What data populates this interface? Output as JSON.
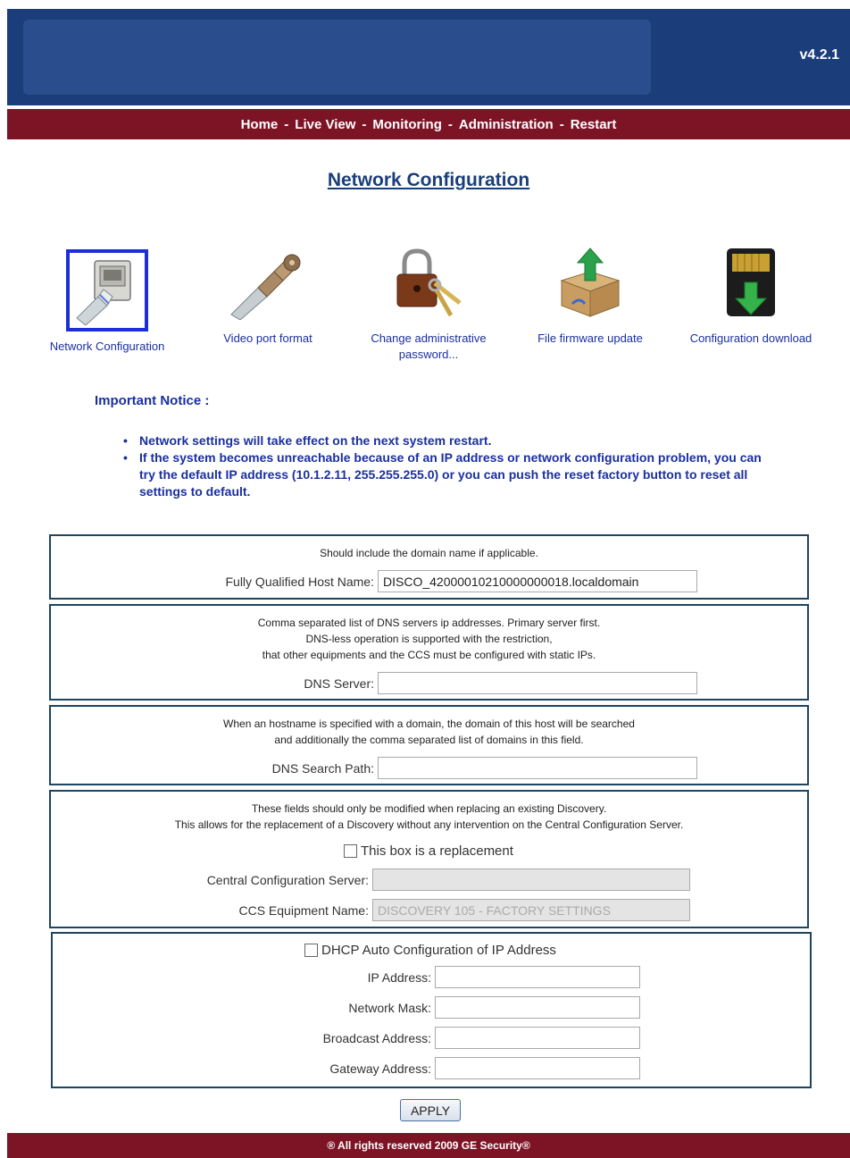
{
  "header": {
    "version": "v4.2.1"
  },
  "nav": {
    "items": [
      "Home",
      "Live View",
      "Monitoring",
      "Administration",
      "Restart"
    ],
    "separator": "-"
  },
  "page": {
    "title": "Network Configuration"
  },
  "tools": [
    {
      "label": "Network Configuration",
      "icon": "network-jack-icon",
      "selected": true
    },
    {
      "label": "Video port format",
      "icon": "bnc-connector-icon"
    },
    {
      "label": "Change administrative password...",
      "icon": "padlock-keys-icon"
    },
    {
      "label": "File firmware update",
      "icon": "box-upload-icon"
    },
    {
      "label": "Configuration download",
      "icon": "sd-card-download-icon"
    }
  ],
  "notice": {
    "title": "Important Notice :",
    "items": [
      "Network settings will take effect on the next system restart.",
      "If the system becomes unreachable because of an IP address or network configuration problem, you can try the default IP address (10.1.2.11, 255.255.255.0) or you can push the reset factory button to reset all settings to default."
    ]
  },
  "host": {
    "help": "Should include the domain name if applicable.",
    "label": "Fully Qualified Host Name:",
    "value": "DISCO_42000010210000000018.localdomain"
  },
  "dns": {
    "help": [
      "Comma separated list of DNS servers ip addresses. Primary server first.",
      "DNS-less operation is supported with the restriction,",
      "that other equipments and the CCS must be configured with static IPs."
    ],
    "label": "DNS Server:",
    "value": ""
  },
  "search": {
    "help": [
      "When an hostname is specified with a domain, the domain of this host will be searched",
      "and additionally the comma separated list of domains in this field."
    ],
    "label": "DNS Search Path:",
    "value": ""
  },
  "replacement": {
    "help": [
      "These fields should only be modified when replacing an existing Discovery.",
      "This allows for the replacement of a Discovery without any intervention on the Central Configuration Server."
    ],
    "checkbox_label": "This box is a replacement",
    "ccs_label": "Central Configuration Server:",
    "ccs_value": "",
    "equipment_label": "CCS Equipment Name:",
    "equipment_value": "DISCOVERY 105 - FACTORY SETTINGS"
  },
  "ip": {
    "dhcp_label": "DHCP Auto Configuration of IP Address",
    "address_label": "IP Address:",
    "address_value": "",
    "mask_label": "Network Mask:",
    "mask_value": "",
    "broadcast_label": "Broadcast Address:",
    "broadcast_value": "",
    "gateway_label": "Gateway Address:",
    "gateway_value": ""
  },
  "apply_label": "APPLY",
  "footer": {
    "text": "® All rights reserved 2009  GE Security®"
  },
  "colors": {
    "header": "#1b3d7a",
    "nav": "#7d1426",
    "title": "#1a3e7a",
    "link": "#1a2fa0"
  }
}
